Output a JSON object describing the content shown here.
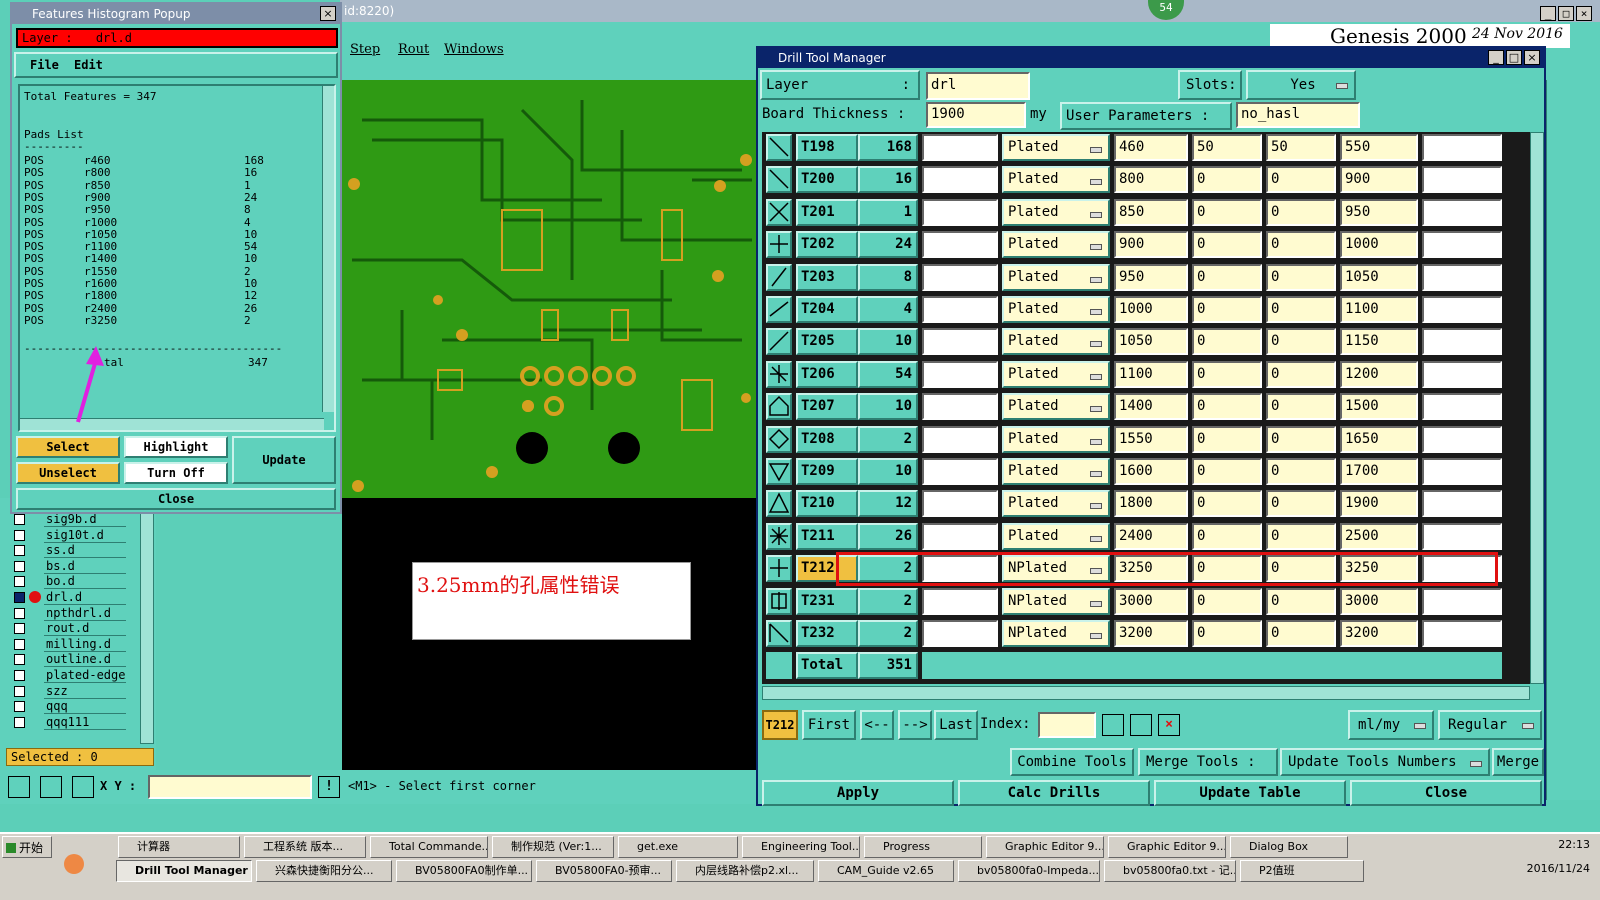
{
  "hist": {
    "title": "Features Histogram Popup",
    "layer_label": "Layer :",
    "layer_value": "drl.d",
    "menu_file": "File",
    "menu_edit": "Edit",
    "total_line": "Total Features = 347",
    "pads_list": "Pads List",
    "pads_sep": "---------",
    "rows": [
      [
        "POS",
        "r460",
        "168"
      ],
      [
        "POS",
        "r800",
        "16"
      ],
      [
        "POS",
        "r850",
        "1"
      ],
      [
        "POS",
        "r900",
        "24"
      ],
      [
        "POS",
        "r950",
        "8"
      ],
      [
        "POS",
        "r1000",
        "4"
      ],
      [
        "POS",
        "r1050",
        "10"
      ],
      [
        "POS",
        "r1100",
        "54"
      ],
      [
        "POS",
        "r1400",
        "10"
      ],
      [
        "POS",
        "r1550",
        "2"
      ],
      [
        "POS",
        "r1600",
        "10"
      ],
      [
        "POS",
        "r1800",
        "12"
      ],
      [
        "POS",
        "r2400",
        "26"
      ],
      [
        "POS",
        "r3250",
        "2"
      ]
    ],
    "dashes": "---------------------------------------",
    "total_label": "tal",
    "total_value": "347",
    "select": "Select",
    "highlight": "Highlight",
    "update": "Update",
    "unselect": "Unselect",
    "turnoff": "Turn Off",
    "close": "Close"
  },
  "main": {
    "title_fragment": "id:8220)",
    "menu": [
      "Step",
      "Rout",
      "Windows"
    ],
    "badge": "54",
    "genesis": "Genesis 2000",
    "date": "24 Nov 2016"
  },
  "layers": [
    "sig9b.d",
    "sig10t.d",
    "ss.d",
    "bs.d",
    "bo.d",
    "drl.d",
    "npthdrl.d",
    "rout.d",
    "milling.d",
    "outline.d",
    "plated-edge",
    "szz",
    "qqq",
    "qqq111"
  ],
  "selected": "Selected : 0",
  "xy_label": "X Y :",
  "status_msg": "<M1> - Select first corner",
  "annotation": "3.25mm的孔属性错误",
  "dtm": {
    "title": "Drill Tool Manager",
    "layer_label": "Layer",
    "layer_colon": ":",
    "layer_value": "drl",
    "slots_label": "Slots:",
    "slots_value": "Yes",
    "thick_label": "Board Thickness :",
    "thick_value": "1900",
    "thick_unit": "my",
    "userparam_label": "User Parameters :",
    "userparam_value": "no_hasl",
    "rows": [
      [
        "T198",
        "168",
        "Plated",
        "460",
        "50",
        "50",
        "550"
      ],
      [
        "T200",
        "16",
        "Plated",
        "800",
        "0",
        "0",
        "900"
      ],
      [
        "T201",
        "1",
        "Plated",
        "850",
        "0",
        "0",
        "950"
      ],
      [
        "T202",
        "24",
        "Plated",
        "900",
        "0",
        "0",
        "1000"
      ],
      [
        "T203",
        "8",
        "Plated",
        "950",
        "0",
        "0",
        "1050"
      ],
      [
        "T204",
        "4",
        "Plated",
        "1000",
        "0",
        "0",
        "1100"
      ],
      [
        "T205",
        "10",
        "Plated",
        "1050",
        "0",
        "0",
        "1150"
      ],
      [
        "T206",
        "54",
        "Plated",
        "1100",
        "0",
        "0",
        "1200"
      ],
      [
        "T207",
        "10",
        "Plated",
        "1400",
        "0",
        "0",
        "1500"
      ],
      [
        "T208",
        "2",
        "Plated",
        "1550",
        "0",
        "0",
        "1650"
      ],
      [
        "T209",
        "10",
        "Plated",
        "1600",
        "0",
        "0",
        "1700"
      ],
      [
        "T210",
        "12",
        "Plated",
        "1800",
        "0",
        "0",
        "1900"
      ],
      [
        "T211",
        "26",
        "Plated",
        "2400",
        "0",
        "0",
        "2500"
      ],
      [
        "T212",
        "2",
        "NPlated",
        "3250",
        "0",
        "0",
        "3250"
      ],
      [
        "T231",
        "2",
        "NPlated",
        "3000",
        "0",
        "0",
        "3000"
      ],
      [
        "T232",
        "2",
        "NPlated",
        "3200",
        "0",
        "0",
        "3200"
      ]
    ],
    "total_label": "Total",
    "total_value": "351",
    "current_tool": "T212",
    "first": "First",
    "prev": "<--",
    "next": "-->",
    "last": "Last",
    "index_label": "Index:",
    "unit": "ml/my",
    "mode": "Regular",
    "combine": "Combine Tools",
    "merge_tools": "Merge Tools :",
    "update_numbers": "Update Tools Numbers",
    "merge": "Merge",
    "apply": "Apply",
    "calc": "Calc Drills",
    "update_table": "Update Table",
    "close": "Close"
  },
  "taskbar": {
    "start": "开始",
    "top": [
      "计算器",
      "工程系统  版本...",
      "Total Commande...",
      "制作规范 (Ver:1...",
      "get.exe",
      "Engineering Tool...",
      "Progress",
      "Graphic Editor 9....",
      "Graphic Editor 9....",
      "Dialog Box"
    ],
    "bottom": [
      "Drill Tool Manager",
      "兴森快捷衡阳分公...",
      "BV05800FA0制作单...",
      "BV05800FA0-预审...",
      "内层线路补偿p2.xl...",
      "CAM_Guide v2.65",
      "bv05800fa0-Impeda...",
      "bv05800fa0.txt - 记...",
      "P2值班"
    ],
    "time": "22:13",
    "date": "2016/11/24"
  },
  "colors": {
    "teal": "#5fd1bc",
    "pcb_green": "#2f9a14",
    "trace": "#155a0a",
    "copper": "#d4a020",
    "highlight_red": "#e01010",
    "layer_red": "#ff0000"
  }
}
